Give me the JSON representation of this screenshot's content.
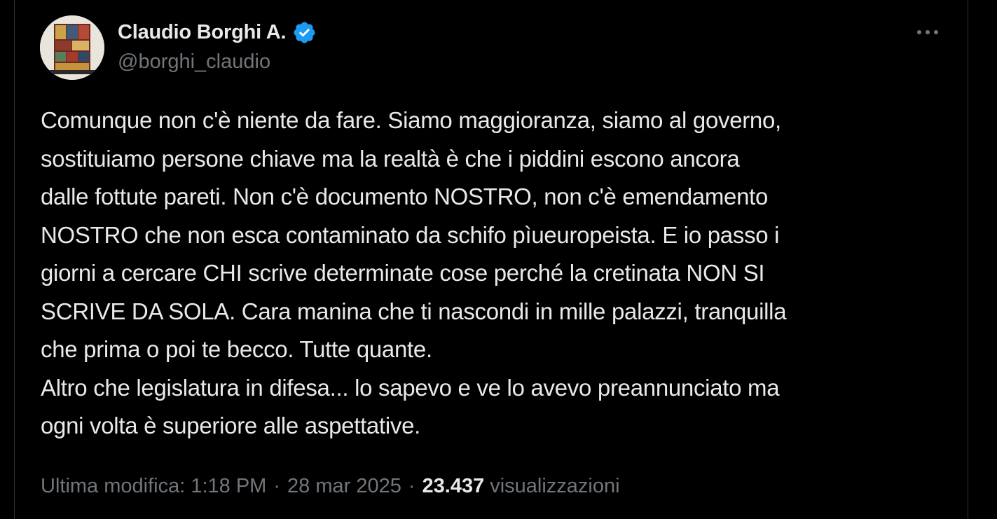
{
  "author": {
    "display_name": "Claudio Borghi A.",
    "handle": "@borghi_claudio",
    "verified_icon": "verified-badge-icon",
    "avatar_icon": "profile-avatar"
  },
  "more_menu": {
    "label": "···",
    "icon": "more-horizontal-icon"
  },
  "tweet": {
    "lines": [
      "Comunque non c'è niente da fare. Siamo maggioranza, siamo al governo,",
      "sostituiamo persone chiave ma la realtà è che i piddini escono ancora",
      "dalle fottute pareti. Non c'è documento NOSTRO, non c'è emendamento",
      "NOSTRO che non esca contaminato da schifo pìueuropeista. E io passo i",
      "giorni a cercare CHI scrive determinate cose perché la cretinata NON SI",
      "SCRIVE DA SOLA. Cara manina che ti nascondi in mille palazzi, tranquilla",
      "che prima o poi te becco. Tutte quante.",
      "Altro che legislatura in difesa... lo sapevo e ve lo avevo preannunciato ma",
      "ogni volta è superiore alle aspettative."
    ]
  },
  "meta": {
    "edited_label": "Ultima modifica: 1:18 PM",
    "separator": "·",
    "date": "28 mar 2025",
    "views_count": "23.437",
    "views_label": "visualizzazioni"
  },
  "colors": {
    "background": "#000000",
    "text_primary": "#e7e9ea",
    "text_secondary": "#71767b",
    "verified_blue": "#1d9bf0",
    "border": "#2f3336"
  }
}
